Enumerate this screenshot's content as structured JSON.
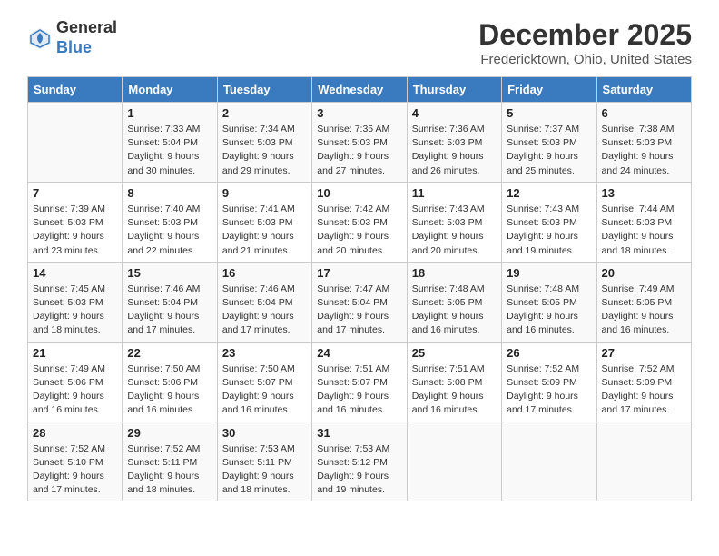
{
  "header": {
    "logo": {
      "general": "General",
      "blue": "Blue"
    },
    "title": "December 2025",
    "location": "Fredericktown, Ohio, United States"
  },
  "weekdays": [
    "Sunday",
    "Monday",
    "Tuesday",
    "Wednesday",
    "Thursday",
    "Friday",
    "Saturday"
  ],
  "weeks": [
    [
      {
        "day": "",
        "info": ""
      },
      {
        "day": "1",
        "info": "Sunrise: 7:33 AM\nSunset: 5:04 PM\nDaylight: 9 hours\nand 30 minutes."
      },
      {
        "day": "2",
        "info": "Sunrise: 7:34 AM\nSunset: 5:03 PM\nDaylight: 9 hours\nand 29 minutes."
      },
      {
        "day": "3",
        "info": "Sunrise: 7:35 AM\nSunset: 5:03 PM\nDaylight: 9 hours\nand 27 minutes."
      },
      {
        "day": "4",
        "info": "Sunrise: 7:36 AM\nSunset: 5:03 PM\nDaylight: 9 hours\nand 26 minutes."
      },
      {
        "day": "5",
        "info": "Sunrise: 7:37 AM\nSunset: 5:03 PM\nDaylight: 9 hours\nand 25 minutes."
      },
      {
        "day": "6",
        "info": "Sunrise: 7:38 AM\nSunset: 5:03 PM\nDaylight: 9 hours\nand 24 minutes."
      }
    ],
    [
      {
        "day": "7",
        "info": "Sunrise: 7:39 AM\nSunset: 5:03 PM\nDaylight: 9 hours\nand 23 minutes."
      },
      {
        "day": "8",
        "info": "Sunrise: 7:40 AM\nSunset: 5:03 PM\nDaylight: 9 hours\nand 22 minutes."
      },
      {
        "day": "9",
        "info": "Sunrise: 7:41 AM\nSunset: 5:03 PM\nDaylight: 9 hours\nand 21 minutes."
      },
      {
        "day": "10",
        "info": "Sunrise: 7:42 AM\nSunset: 5:03 PM\nDaylight: 9 hours\nand 20 minutes."
      },
      {
        "day": "11",
        "info": "Sunrise: 7:43 AM\nSunset: 5:03 PM\nDaylight: 9 hours\nand 20 minutes."
      },
      {
        "day": "12",
        "info": "Sunrise: 7:43 AM\nSunset: 5:03 PM\nDaylight: 9 hours\nand 19 minutes."
      },
      {
        "day": "13",
        "info": "Sunrise: 7:44 AM\nSunset: 5:03 PM\nDaylight: 9 hours\nand 18 minutes."
      }
    ],
    [
      {
        "day": "14",
        "info": "Sunrise: 7:45 AM\nSunset: 5:03 PM\nDaylight: 9 hours\nand 18 minutes."
      },
      {
        "day": "15",
        "info": "Sunrise: 7:46 AM\nSunset: 5:04 PM\nDaylight: 9 hours\nand 17 minutes."
      },
      {
        "day": "16",
        "info": "Sunrise: 7:46 AM\nSunset: 5:04 PM\nDaylight: 9 hours\nand 17 minutes."
      },
      {
        "day": "17",
        "info": "Sunrise: 7:47 AM\nSunset: 5:04 PM\nDaylight: 9 hours\nand 17 minutes."
      },
      {
        "day": "18",
        "info": "Sunrise: 7:48 AM\nSunset: 5:05 PM\nDaylight: 9 hours\nand 16 minutes."
      },
      {
        "day": "19",
        "info": "Sunrise: 7:48 AM\nSunset: 5:05 PM\nDaylight: 9 hours\nand 16 minutes."
      },
      {
        "day": "20",
        "info": "Sunrise: 7:49 AM\nSunset: 5:05 PM\nDaylight: 9 hours\nand 16 minutes."
      }
    ],
    [
      {
        "day": "21",
        "info": "Sunrise: 7:49 AM\nSunset: 5:06 PM\nDaylight: 9 hours\nand 16 minutes."
      },
      {
        "day": "22",
        "info": "Sunrise: 7:50 AM\nSunset: 5:06 PM\nDaylight: 9 hours\nand 16 minutes."
      },
      {
        "day": "23",
        "info": "Sunrise: 7:50 AM\nSunset: 5:07 PM\nDaylight: 9 hours\nand 16 minutes."
      },
      {
        "day": "24",
        "info": "Sunrise: 7:51 AM\nSunset: 5:07 PM\nDaylight: 9 hours\nand 16 minutes."
      },
      {
        "day": "25",
        "info": "Sunrise: 7:51 AM\nSunset: 5:08 PM\nDaylight: 9 hours\nand 16 minutes."
      },
      {
        "day": "26",
        "info": "Sunrise: 7:52 AM\nSunset: 5:09 PM\nDaylight: 9 hours\nand 17 minutes."
      },
      {
        "day": "27",
        "info": "Sunrise: 7:52 AM\nSunset: 5:09 PM\nDaylight: 9 hours\nand 17 minutes."
      }
    ],
    [
      {
        "day": "28",
        "info": "Sunrise: 7:52 AM\nSunset: 5:10 PM\nDaylight: 9 hours\nand 17 minutes."
      },
      {
        "day": "29",
        "info": "Sunrise: 7:52 AM\nSunset: 5:11 PM\nDaylight: 9 hours\nand 18 minutes."
      },
      {
        "day": "30",
        "info": "Sunrise: 7:53 AM\nSunset: 5:11 PM\nDaylight: 9 hours\nand 18 minutes."
      },
      {
        "day": "31",
        "info": "Sunrise: 7:53 AM\nSunset: 5:12 PM\nDaylight: 9 hours\nand 19 minutes."
      },
      {
        "day": "",
        "info": ""
      },
      {
        "day": "",
        "info": ""
      },
      {
        "day": "",
        "info": ""
      }
    ]
  ]
}
